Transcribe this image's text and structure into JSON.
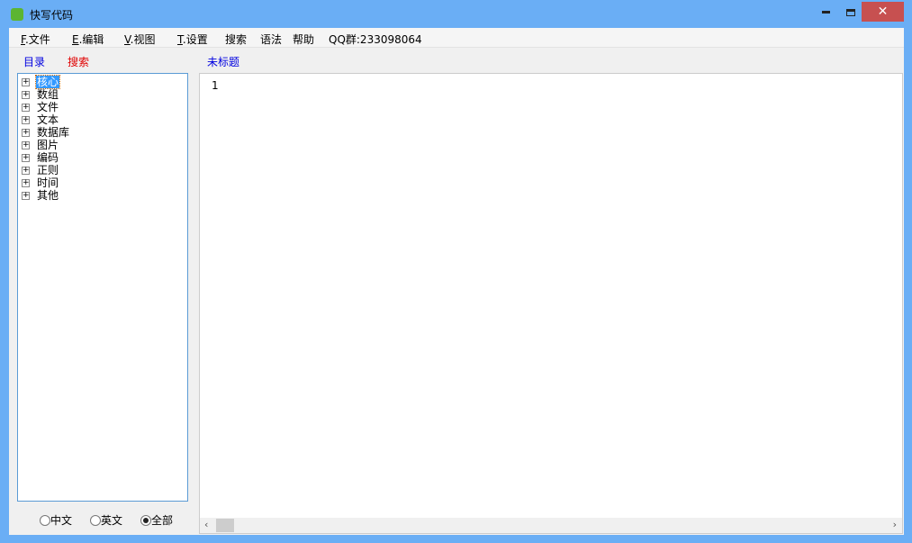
{
  "window": {
    "title": "快写代码",
    "close": "✕"
  },
  "menu": [
    {
      "key": "F",
      "label": ".文件"
    },
    {
      "key": "E",
      "label": ".编辑"
    },
    {
      "key": "V",
      "label": ".视图"
    },
    {
      "key": "T",
      "label": ".设置"
    },
    {
      "key": "",
      "label": "搜索"
    },
    {
      "key": "",
      "label": "语法"
    },
    {
      "key": "",
      "label": "帮助"
    },
    {
      "key": "",
      "label": "QQ群:233098064"
    }
  ],
  "left_tabs": {
    "catalog": "目录",
    "search": "搜索"
  },
  "editor_tab": "未标题",
  "tree": [
    "核心",
    "数组",
    "文件",
    "文本",
    "数据库",
    "图片",
    "编码",
    "正则",
    "时间",
    "其他"
  ],
  "radios": [
    {
      "label": "中文",
      "checked": false
    },
    {
      "label": "英文",
      "checked": false
    },
    {
      "label": "全部",
      "checked": true
    }
  ],
  "editor": {
    "line_number": "1"
  },
  "scroll": {
    "left": "‹",
    "right": "›"
  }
}
